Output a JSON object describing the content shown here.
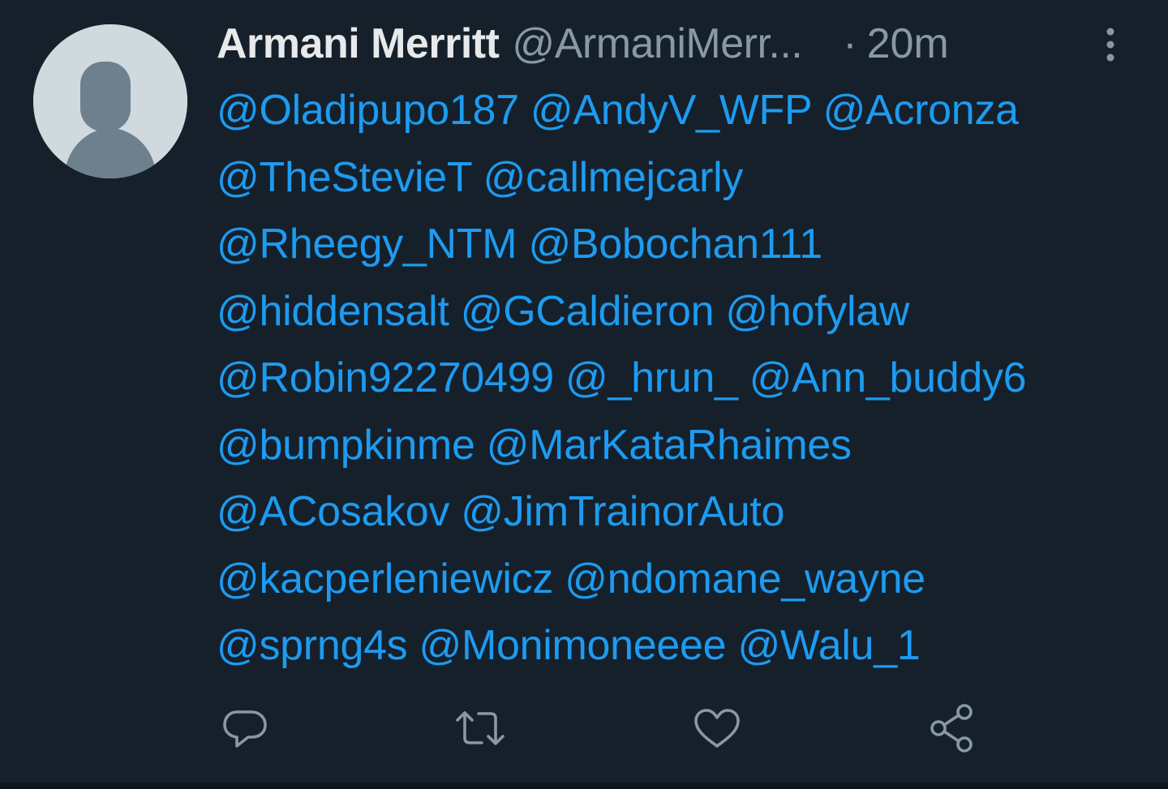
{
  "tweet": {
    "display_name": "Armani Merritt",
    "handle": "@ArmaniMerr...",
    "separator": "·",
    "time": "20m",
    "lines": [
      [
        "@Oladipupo187",
        "@AndyV_WFP",
        "@Acronza"
      ],
      [
        "@TheStevieT",
        "@callmejcarly"
      ],
      [
        "@Rheegy_NTM",
        "@Bobochan111"
      ],
      [
        "@hiddensalt",
        "@GCaldieron",
        "@hofylaw"
      ],
      [
        "@Robin92270499",
        "@_hrun_",
        "@Ann_buddy6"
      ],
      [
        "@bumpkinme",
        "@MarKataRhaimes"
      ],
      [
        "@ACosakov",
        "@JimTrainorAuto"
      ],
      [
        "@kacperleniewicz",
        "@ndomane_wayne"
      ],
      [
        "@sprng4s",
        "@Monimoneeee",
        "@Walu_1"
      ]
    ]
  },
  "actions": {
    "reply_icon": "reply-icon",
    "retweet_icon": "retweet-icon",
    "like_icon": "heart-icon",
    "share_icon": "share-icon",
    "more_icon": "more-vertical-icon"
  },
  "colors": {
    "background": "#15202b",
    "mention": "#1d9bf0",
    "name": "#e7e9ea",
    "secondary": "#8899a6",
    "avatar_bg": "#cfd9de",
    "avatar_figure": "#6e7f8d"
  }
}
